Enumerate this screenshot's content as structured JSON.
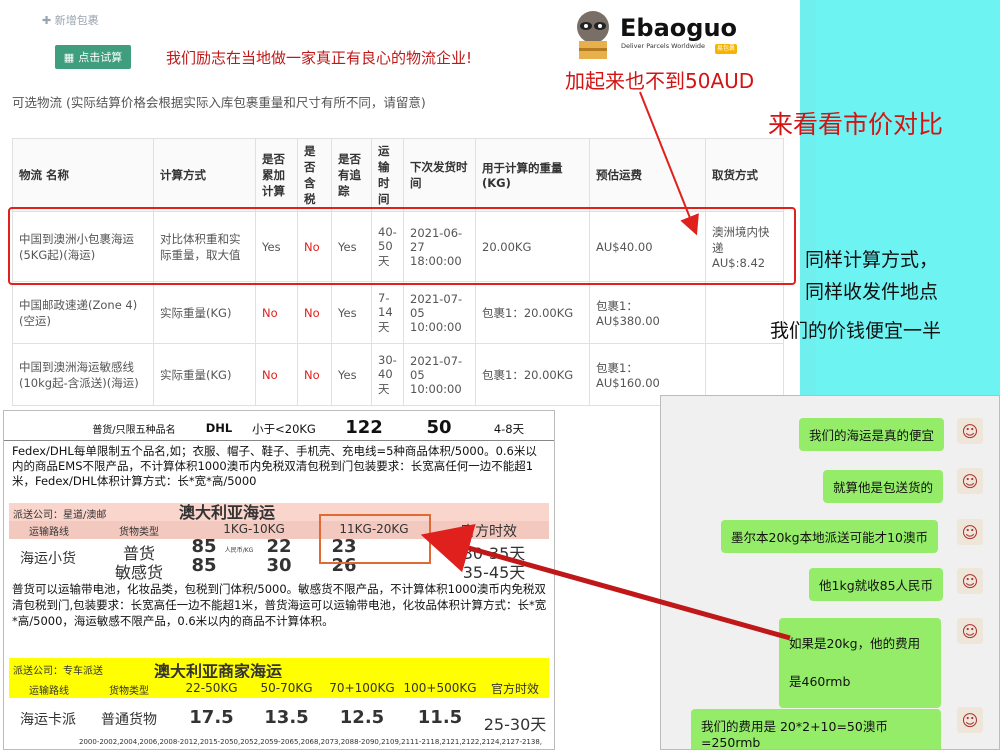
{
  "header": {
    "add_package": "✚ 新增包裹",
    "calc_button": "点击试算",
    "slogan": "我们励志在当地做一家真正有良心的物流企业!",
    "options_title": "可选物流 (实际结算价格会根据实际入库包裹重量和尺寸有所不同，请留意)"
  },
  "logo": {
    "name": "Ebaoguo",
    "tagline": "Deliver Parcels Worldwide",
    "badge": "易包裹"
  },
  "annotations": {
    "under_50": "加起来也不到50AUD",
    "compare": "来看看市价对比",
    "same_method": "同样计算方式，",
    "same_location": "同样收发件地点",
    "half_price": "我们的价钱便宜一半"
  },
  "table": {
    "headers": [
      "物流 名称",
      "计算方式",
      "是否累加计算",
      "是否含税",
      "是否有追踪",
      "运输时间",
      "下次发货时间",
      "用于计算的重量(KG)",
      "预估运费",
      "取货方式"
    ],
    "rows": [
      [
        "中国到澳洲小包裹海运(5KG起)(海运)",
        "对比体积重和实际重量，取大值",
        "Yes",
        "No",
        "Yes",
        "40-50天",
        "2021-06-27 18:00:00",
        "20.00KG",
        "AU$40.00",
        "澳洲境内快递 AU$:8.42"
      ],
      [
        "中国邮政速递(Zone 4)(空运)",
        "实际重量(KG)",
        "No",
        "No",
        "Yes",
        "7-14天",
        "2021-07-05 10:00:00",
        "包裹1：20.00KG",
        "包裹1：AU$380.00",
        ""
      ],
      [
        "中国到澳洲海运敏感线(10kg起-含派送)(海运)",
        "实际重量(KG)",
        "No",
        "No",
        "Yes",
        "30-40天",
        "2021-07-05 10:00:00",
        "包裹1：20.00KG",
        "包裹1：AU$160.00",
        ""
      ]
    ]
  },
  "price_sheet": {
    "top_row": [
      "普货/只限五种品名",
      "DHL",
      "小于<20KG",
      "122",
      "50",
      "4-8天"
    ],
    "fedex_note": "Fedex/DHL每单限制五个品名,如；衣服、帽子、鞋子、手机壳、充电线=5种商品体积/5000。0.6米以内的商品EMS不限产品，不计算体积1000澳币内免税双清包税到门包装要求：长宽高任何一边不能超1米，Fedex/DHL体积计算方式：长*宽*高/5000",
    "sea_company": "派送公司：星道/澳邮",
    "sea_title": "澳大利亚海运",
    "sea_headers": [
      "运输路线",
      "货物类型",
      "1KG-10KG",
      "11KG-20KG",
      "官方时效"
    ],
    "sea_route": "海运小货",
    "sea_rows": [
      [
        "普货",
        "85",
        "22",
        "23",
        "30-35天"
      ],
      [
        "敏感货",
        "85",
        "30",
        "26",
        "35-45天"
      ]
    ],
    "sea_unit": "人民币/KG",
    "sea_note": "普货可以运输带电池，化妆品类，包税到门体积/5000。敏感货不限产品，不计算体积1000澳币内免税双清包税到门,包装要求：长宽高任一边不能超1米，普货海运可以运输带电池，化妆品体积计算方式：长*宽*高/5000，海运敏感不限产品，0.6米以内的商品不计算体积。",
    "truck_company": "派送公司：专车派送",
    "truck_title": "澳大利亚商家海运",
    "truck_headers": [
      "运输路线",
      "货物类型",
      "22-50KG",
      "50-70KG",
      "70+100KG",
      "100+500KG",
      "官方时效"
    ],
    "truck_row": [
      "海运卡派",
      "普通货物",
      "17.5",
      "13.5",
      "12.5",
      "11.5",
      "25-30天"
    ],
    "postcodes": "2000-2002,2004,2006,2008-2012,2015-2050,2052,2059-2065,2068,2073,2088-2090,2109,2111-2118,2121,2122,2124,2127-2138,"
  },
  "chat": {
    "messages": [
      "我们的海运是真的便宜",
      "就算他是包送货的",
      "墨尔本20kg本地派送可能才10澳币",
      "他1kg就收85人民币",
      "如果是20kg，他的费用是460rmb",
      "我们的费用是 20*2+10=50澳币=250rmb"
    ]
  },
  "colors": {
    "accent_red": "#e0201c",
    "cyan": "#6ef3f3",
    "button_green": "#3f9e7e",
    "chat_green": "#95ec69"
  }
}
